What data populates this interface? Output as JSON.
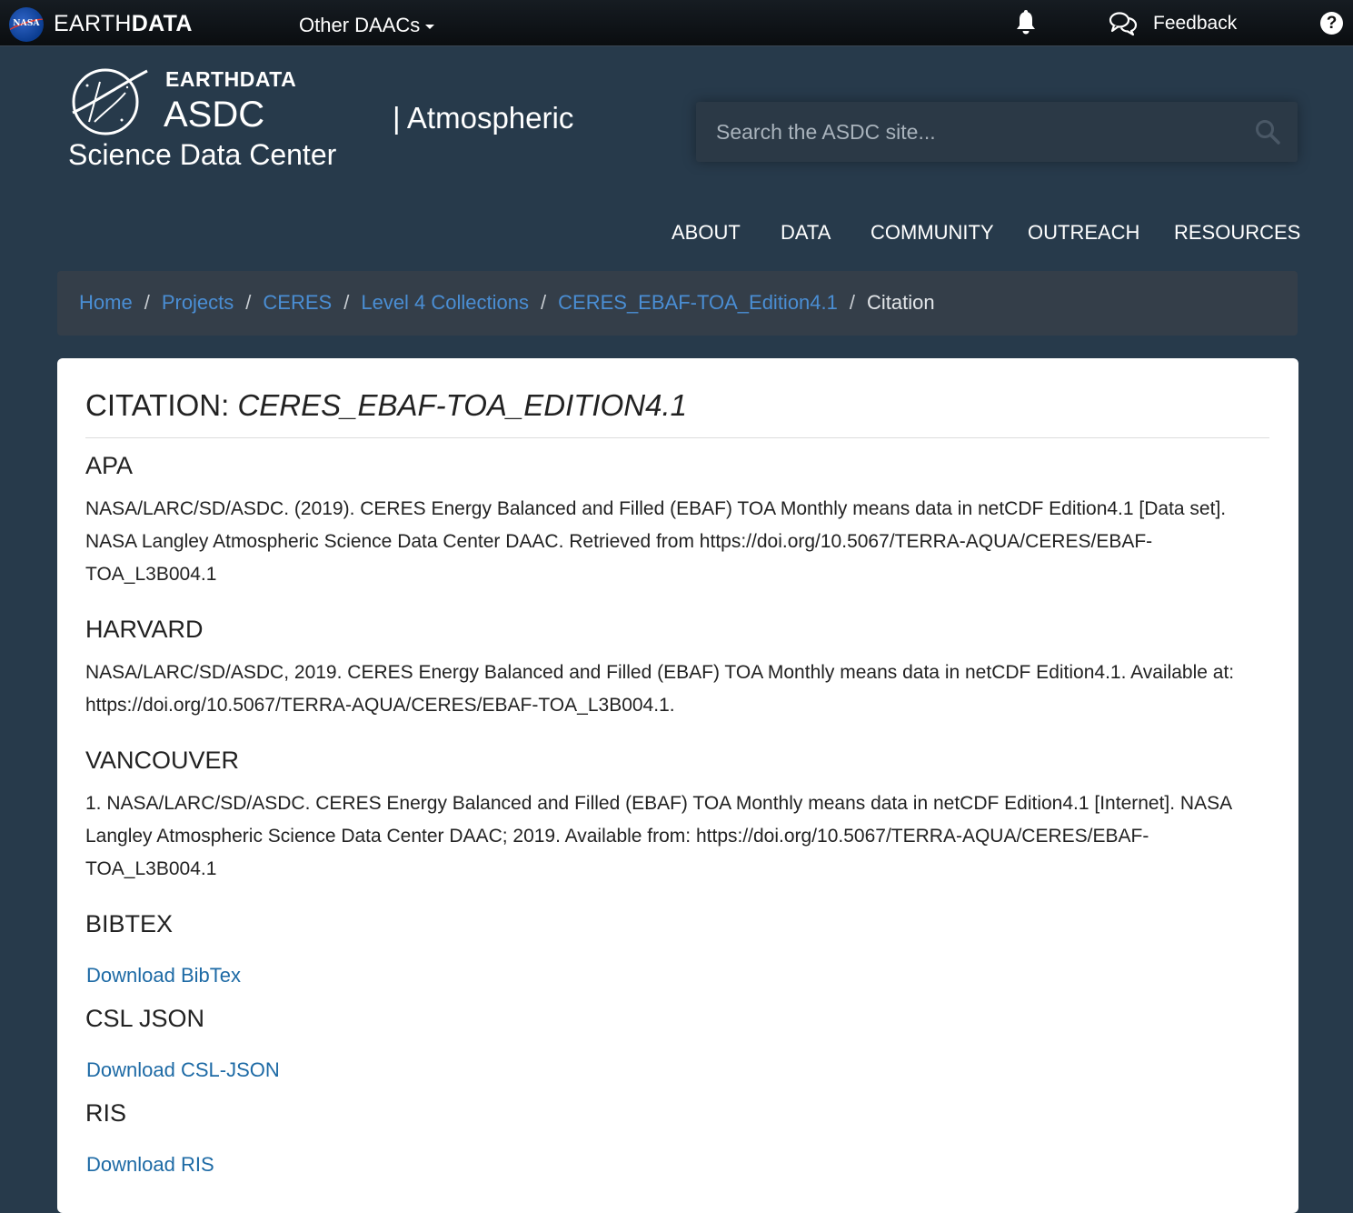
{
  "topbar": {
    "nasa_logo": "NASA",
    "brand_light": "EARTH",
    "brand_bold": "DATA",
    "other_daacs": "Other DAACs",
    "bell_icon": "bell-icon",
    "feedback_icon": "chat-bubbles-icon",
    "feedback_label": "Feedback",
    "help_icon": "question-circle-icon",
    "help_glyph": "?"
  },
  "header": {
    "logo_earthdata": "EARTHDATA",
    "logo_name": "ASDC",
    "logo_sub": "Science Data Center",
    "logo_atmos": "| Atmospheric",
    "search_placeholder": "Search the ASDC site...",
    "search_icon": "search-icon"
  },
  "nav": {
    "items": [
      {
        "label": "ABOUT"
      },
      {
        "label": "DATA"
      },
      {
        "label": "COMMUNITY"
      },
      {
        "label": "OUTREACH"
      },
      {
        "label": "RESOURCES"
      }
    ]
  },
  "breadcrumb": {
    "separator": "/",
    "items": [
      {
        "label": "Home"
      },
      {
        "label": "Projects"
      },
      {
        "label": "CERES"
      },
      {
        "label": "Level 4 Collections"
      },
      {
        "label": "CERES_EBAF-TOA_Edition4.1"
      }
    ],
    "current": "Citation"
  },
  "content": {
    "title_prefix": "CITATION: ",
    "title_dataset": "CERES_EBAF-TOA_EDITION4.1",
    "sections": [
      {
        "heading": "APA",
        "text": "NASA/LARC/SD/ASDC. (2019). CERES Energy Balanced and Filled (EBAF) TOA Monthly means data in netCDF Edition4.1 [Data set]. NASA Langley Atmospheric Science Data Center DAAC. Retrieved from https://doi.org/10.5067/TERRA-AQUA/CERES/EBAF-TOA_L3B004.1"
      },
      {
        "heading": "HARVARD",
        "text": "NASA/LARC/SD/ASDC, 2019. CERES Energy Balanced and Filled (EBAF) TOA Monthly means data in netCDF Edition4.1. Available at: https://doi.org/10.5067/TERRA-AQUA/CERES/EBAF-TOA_L3B004.1."
      },
      {
        "heading": "VANCOUVER",
        "text": "1. NASA/LARC/SD/ASDC. CERES Energy Balanced and Filled (EBAF) TOA Monthly means data in netCDF Edition4.1 [Internet]. NASA Langley Atmospheric Science Data Center DAAC; 2019. Available from: https://doi.org/10.5067/TERRA-AQUA/CERES/EBAF-TOA_L3B004.1"
      },
      {
        "heading": "BIBTEX",
        "link": "Download BibTex"
      },
      {
        "heading": "CSL JSON",
        "link": "Download CSL-JSON"
      },
      {
        "heading": "RIS",
        "link": "Download RIS"
      }
    ]
  },
  "colors": {
    "page_bg": "#273a4b",
    "topbar_bg": "#0d1115",
    "breadcrumb_bg": "#343e49",
    "breadcrumb_link": "#4a8ed4",
    "content_link": "#1d6aa5",
    "nasa_blue": "#0b3d91",
    "nasa_red": "#e23b2e"
  }
}
